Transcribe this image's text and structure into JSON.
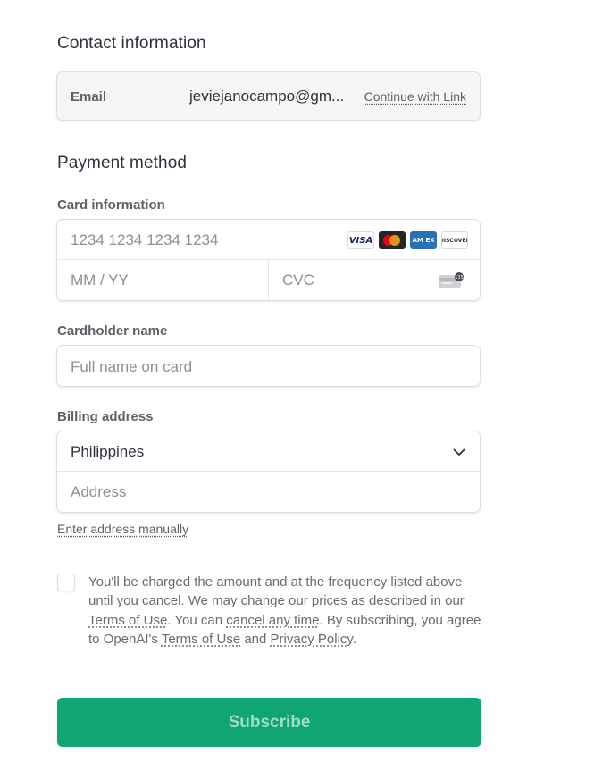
{
  "contact": {
    "title": "Contact information",
    "email_label": "Email",
    "email_value": "jeviejanocampo@gm...",
    "link_label": "Continue with Link"
  },
  "payment": {
    "title": "Payment method",
    "card_label": "Card information",
    "card_number_placeholder": "1234 1234 1234 1234",
    "expiry_placeholder": "MM / YY",
    "cvc_placeholder": "CVC",
    "cvc_badge": "135",
    "card_brands": [
      {
        "name": "visa-icon",
        "text": "VISA",
        "color": "#1a1f71"
      },
      {
        "name": "mastercard-icon",
        "text": "",
        "color": "#eb001b"
      },
      {
        "name": "amex-icon",
        "text": "AM EX",
        "color": "#2671b9"
      },
      {
        "name": "discover-icon",
        "text": "DISCOVER",
        "color": "#f58220"
      }
    ]
  },
  "cardholder": {
    "label": "Cardholder name",
    "placeholder": "Full name on card"
  },
  "billing": {
    "label": "Billing address",
    "country": "Philippines",
    "address_placeholder": "Address",
    "manual_link": "Enter address manually"
  },
  "consent": {
    "text_1": "You'll be charged the amount and at the frequency listed above until you cancel. We may change our prices as described in our ",
    "terms_link_1": "Terms of Use",
    "text_2": ". You can ",
    "cancel_link": "cancel any time",
    "text_3": ". By subscribing, you agree to OpenAI's ",
    "terms_link_2": "Terms of Use",
    "text_4": " and ",
    "privacy_link": "Privacy Policy",
    "text_5": "."
  },
  "subscribe_label": "Subscribe",
  "colors": {
    "accent": "#10a574",
    "text": "#30313d",
    "muted": "#5f6168",
    "placeholder": "#8e8f95",
    "border": "#dedfe3"
  }
}
